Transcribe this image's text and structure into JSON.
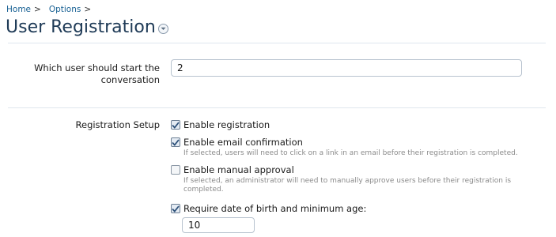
{
  "breadcrumb": {
    "items": [
      {
        "label": "Home",
        "sep": ">"
      },
      {
        "label": "Options",
        "sep": ">"
      }
    ]
  },
  "header": {
    "title": "User Registration",
    "menu_icon": "chevron-down-circle-icon"
  },
  "conversation_user": {
    "label": "Which user should start the conversation",
    "value": "2"
  },
  "registration_setup": {
    "label": "Registration Setup",
    "options": [
      {
        "label": "Enable registration",
        "checked": true,
        "hint": ""
      },
      {
        "label": "Enable email confirmation",
        "checked": true,
        "hint": "If selected, users will need to click on a link in an email before their registration is completed."
      },
      {
        "label": "Enable manual approval",
        "checked": false,
        "hint": "If selected, an administrator will need to manually approve users before their registration is completed."
      },
      {
        "label": "Require date of birth and minimum age:",
        "checked": true,
        "hint": ""
      }
    ],
    "min_age_value": "10"
  },
  "colors": {
    "link": "#176093",
    "title": "#1e3a56",
    "hint": "#8b8b8b",
    "divider": "#dfe6ee"
  }
}
